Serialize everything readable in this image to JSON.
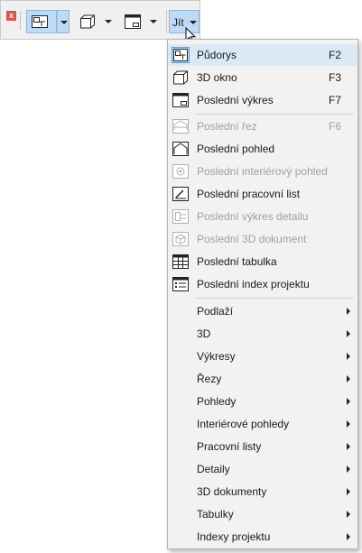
{
  "toolbar": {
    "close_icon": "close-x-icon",
    "buttons": [
      {
        "icon": "floor-plan-icon"
      },
      {
        "icon": "3d-window-icon"
      },
      {
        "icon": "layout-icon"
      }
    ],
    "go_label": "Jít",
    "go_icon": "chevron-down-icon"
  },
  "menu": {
    "views": [
      {
        "label": "Půdorys",
        "shortcut": "F2",
        "icon": "floor-plan-icon"
      },
      {
        "label": "3D okno",
        "shortcut": "F3",
        "icon": "3d-window-icon"
      },
      {
        "label": "Poslední výkres",
        "shortcut": "F7",
        "icon": "layout-icon"
      }
    ],
    "recent": [
      {
        "label": "Poslední řez",
        "shortcut": "F6",
        "icon": "section-icon"
      },
      {
        "label": "Poslední pohled",
        "icon": "elevation-icon"
      },
      {
        "label": "Poslední interiérový pohled",
        "icon": "interior-elevation-icon"
      },
      {
        "label": "Poslední pracovní list",
        "icon": "worksheet-icon"
      },
      {
        "label": "Poslední výkres detailu",
        "icon": "detail-icon"
      },
      {
        "label": "Poslední 3D dokument",
        "icon": "3d-document-icon"
      },
      {
        "label": "Poslední tabulka",
        "icon": "schedule-icon"
      },
      {
        "label": "Poslední index projektu",
        "icon": "project-index-icon"
      }
    ],
    "submenus": [
      {
        "label": "Podlaží"
      },
      {
        "label": "3D"
      },
      {
        "label": "Výkresy"
      },
      {
        "label": "Řezy"
      },
      {
        "label": "Pohledy"
      },
      {
        "label": "Interiérové pohledy"
      },
      {
        "label": "Pracovní listy"
      },
      {
        "label": "Detaily"
      },
      {
        "label": "3D dokumenty"
      },
      {
        "label": "Tabulky"
      },
      {
        "label": "Indexy projektu"
      }
    ]
  }
}
